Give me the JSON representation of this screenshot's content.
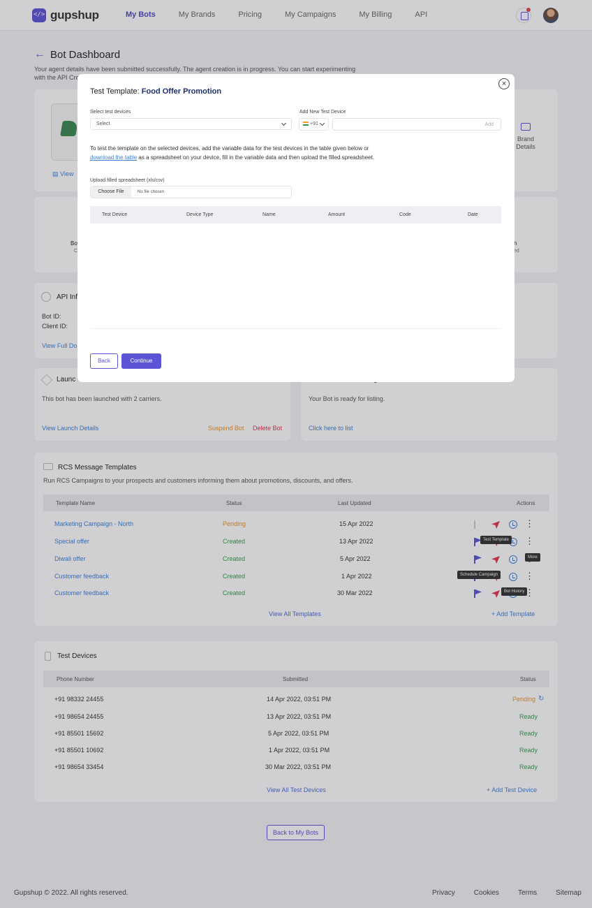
{
  "header": {
    "logo": "gupshup",
    "nav": [
      "My Bots",
      "My Brands",
      "Pricing",
      "My Campaigns",
      "My Billing",
      "API"
    ],
    "active_nav": "My Bots"
  },
  "page": {
    "title": "Bot Dashboard",
    "description_line1": "Your agent details have been submitted successfully. The agent creation is in progress. You can start experimenting",
    "description_line2": "with the API Cre",
    "view_link": "View",
    "brand_details_line1": "Brand",
    "brand_details_line2": "Details"
  },
  "stats_fragments": {
    "left1": "Bo",
    "left2": "C",
    "right1": "h",
    "right2": "ted"
  },
  "api_info": {
    "title": "API Inf",
    "bot_id_label": "Bot ID:",
    "client_id_label": "Client ID:",
    "view_full": "View Full Do"
  },
  "launch": {
    "title": "Launc",
    "text": "This bot has been launched with 2 carriers.",
    "view_details": "View Launch Details",
    "suspend": "Suspend Bot",
    "delete": "Delete Bot"
  },
  "listing": {
    "title_fragment": "g",
    "text": "Your Bot is ready for listing.",
    "link": "Click here to list"
  },
  "templates": {
    "title": "RCS Message Templates",
    "subtitle": "Run RCS Campaigns to your prospects and customers informing them about promotions, discounts, and offers.",
    "headers": [
      "Template Name",
      "Status",
      "Last Updated",
      "Actions"
    ],
    "rows": [
      {
        "name": "Marketing Campaign - North",
        "status": "Pending",
        "date": "15 Apr 2022"
      },
      {
        "name": "Special offer",
        "status": "Created",
        "date": "13 Apr 2022"
      },
      {
        "name": "Diwali offer",
        "status": "Created",
        "date": "5 Apr 2022"
      },
      {
        "name": "Customer feedback",
        "status": "Created",
        "date": "1 Apr 2022"
      },
      {
        "name": "Customer feedback",
        "status": "Created",
        "date": "30 Mar 2022"
      }
    ],
    "tooltips": {
      "test": "Test Template",
      "more": "More",
      "schedule": "Schedule Campaign",
      "history": "Bot History"
    },
    "view_all": "View All Templates",
    "add": "+ Add Template"
  },
  "test_devices": {
    "title": "Test Devices",
    "headers": [
      "Phone Number",
      "Submitted",
      "Status"
    ],
    "rows": [
      {
        "phone": "+91 98332 24455",
        "submitted": "14 Apr 2022, 03:51 PM",
        "status": "Pending"
      },
      {
        "phone": "+91 98654 24455",
        "submitted": "13 Apr 2022, 03:51 PM",
        "status": "Ready"
      },
      {
        "phone": "+91 85501 15692",
        "submitted": "5 Apr 2022, 03:51 PM",
        "status": "Ready"
      },
      {
        "phone": "+91 85501 10692",
        "submitted": "1 Apr 2022, 03:51 PM",
        "status": "Ready"
      },
      {
        "phone": "+91 98654 33454",
        "submitted": "30 Mar 2022, 03:51 PM",
        "status": "Ready"
      }
    ],
    "view_all": "View All Test Devices",
    "add": "+ Add Test Device"
  },
  "back_to_bots": "Back to My Bots",
  "footer": {
    "copyright": "Gupshup © 2022. All rights reserved.",
    "links": [
      "Privacy",
      "Cookies",
      "Terms",
      "Sitemap"
    ]
  },
  "modal": {
    "title_prefix": "Test Template:",
    "title_name": "Food Offer Promotion",
    "select_label": "Select test devices",
    "select_value": "Select",
    "add_label": "Add New Test Device",
    "country_code": "+91",
    "add_button": "Add",
    "info_line1": "To test the template on the selected devices, add the variable data for the test devices in the table given below or",
    "info_link": "download the table",
    "info_line2": " as a spreadsheet on your device, fill in the variable data and then upload the filled spreadsheet.",
    "upload_label": "Upload filled spreadsheet (xls/csv)",
    "choose_file": "Choose File",
    "no_file": "No file chosen",
    "columns": [
      "Test Device",
      "Device Type",
      "Name",
      "Amount",
      "Code",
      "Date"
    ],
    "back": "Back",
    "continue": "Continue"
  },
  "colors": {
    "primary": "#5b55d6",
    "link": "#3f7fd6",
    "success": "#3a9c4a",
    "pending": "#e8942a",
    "danger": "#e0364f"
  }
}
